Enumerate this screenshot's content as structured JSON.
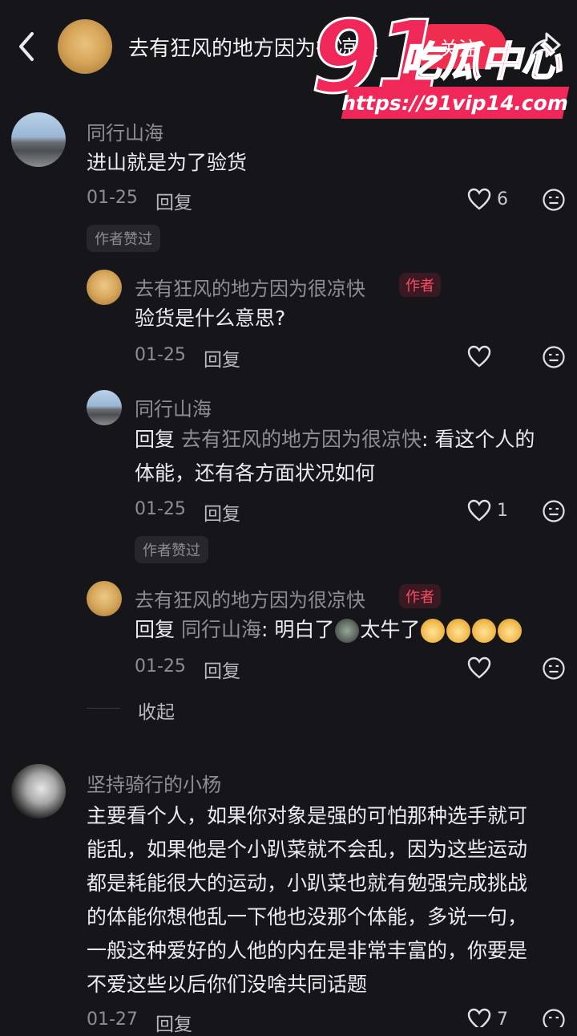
{
  "header": {
    "title": "去有狂风的地方因为很凉快",
    "follow_label": "关注"
  },
  "watermark": {
    "brand_number": "91",
    "brand_name": "吃瓜中心",
    "url": "https://91vip14.com"
  },
  "comments": [
    {
      "user": "同行山海",
      "text": "进山就是为了验货",
      "date": "01-25",
      "reply_label": "回复",
      "likes": "6",
      "liked_by_author": "作者赞过"
    },
    {
      "user": "去有狂风的地方因为很凉快",
      "author_badge": "作者",
      "text": "验货是什么意思?",
      "date": "01-25",
      "reply_label": "回复"
    },
    {
      "user": "同行山海",
      "reply_prefix": "回复",
      "reply_to": "去有狂风的地方因为很凉快",
      "text_line1": ": 看这个人的",
      "text_line2": "体能，还有各方面状况如何",
      "date": "01-25",
      "reply_label": "回复",
      "likes": "1",
      "liked_by_author": "作者赞过"
    },
    {
      "user": "去有狂风的地方因为很凉快",
      "author_badge": "作者",
      "reply_prefix": "回复",
      "reply_to": "同行山海",
      "text_part1": ": 明白了",
      "text_part2": "太牛了",
      "date": "01-25",
      "reply_label": "回复"
    },
    {
      "user": "坚持骑行的小杨",
      "lines": [
        "主要看个人，如果你对象是强的可怕那种选手就可",
        "能乱，如果他是个小趴菜就不会乱，因为这些运动",
        "都是耗能很大的运动，小趴菜也就有勉强完成挑战",
        "的体能你想他乱一下他也没那个体能，多说一句，",
        "一般这种爱好的人他的内在是非常丰富的，你要是",
        "不爱这些以后你们没啥共同话题"
      ],
      "date": "01-27",
      "reply_label": "回复",
      "likes": "7"
    }
  ],
  "collapse_label": "收起"
}
